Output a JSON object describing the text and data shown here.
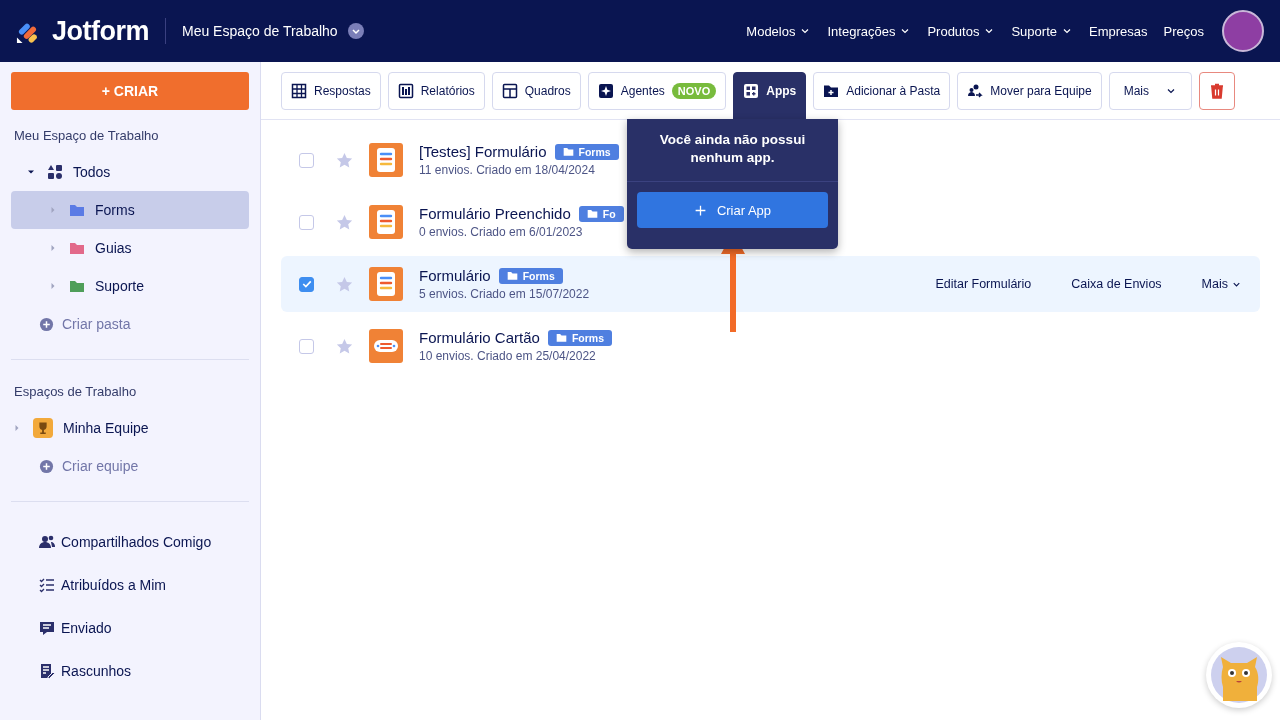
{
  "header": {
    "logo_text": "Jotform",
    "workspace": "Meu Espaço de Trabalho",
    "nav": [
      {
        "label": "Modelos",
        "dropdown": true
      },
      {
        "label": "Integrações",
        "dropdown": true
      },
      {
        "label": "Produtos",
        "dropdown": true
      },
      {
        "label": "Suporte",
        "dropdown": true
      },
      {
        "label": "Empresas",
        "dropdown": false
      },
      {
        "label": "Preços",
        "dropdown": false
      }
    ]
  },
  "sidebar": {
    "create_button": "+ CRIAR",
    "workspace_title": "Meu Espaço de Trabalho",
    "tree": [
      {
        "label": "Todos",
        "kind": "all",
        "expanded": true,
        "selected": false,
        "children": [
          {
            "label": "Forms",
            "kind": "folder",
            "color": "#5b7be5",
            "expanded": false,
            "selected": true
          },
          {
            "label": "Guias",
            "kind": "folder",
            "color": "#e2698a",
            "expanded": false,
            "selected": false
          },
          {
            "label": "Suporte",
            "kind": "folder",
            "color": "#4f9e5a",
            "expanded": false,
            "selected": false
          }
        ]
      }
    ],
    "create_folder": "Criar pasta",
    "teams_title": "Espaços de Trabalho",
    "teams": [
      {
        "label": "Minha Equipe",
        "expanded": false
      }
    ],
    "create_team": "Criar equipe",
    "links": [
      {
        "label": "Compartilhados Comigo",
        "kind": "shared"
      },
      {
        "label": "Atribuídos a Mim",
        "kind": "assigned"
      },
      {
        "label": "Enviado",
        "kind": "sent"
      },
      {
        "label": "Rascunhos",
        "kind": "drafts"
      }
    ]
  },
  "toolbar": [
    {
      "label": "Respostas",
      "kind": "grid",
      "selected": false
    },
    {
      "label": "Relatórios",
      "kind": "report",
      "selected": false
    },
    {
      "label": "Quadros",
      "kind": "board",
      "selected": false
    },
    {
      "label": "Agentes",
      "kind": "agent",
      "badge": "NOVO",
      "selected": false
    },
    {
      "label": "Apps",
      "kind": "apps",
      "selected": true
    },
    {
      "label": "Adicionar à Pasta",
      "kind": "folder",
      "selected": false
    },
    {
      "label": "Mover para Equipe",
      "kind": "team",
      "selected": false
    },
    {
      "label": "Mais",
      "kind": "more",
      "selected": false
    },
    {
      "kind": "delete",
      "selected": false
    }
  ],
  "forms": [
    {
      "title": "[Testes] Formulário",
      "tag": "Forms",
      "meta": "11 envios. Criado em 18/04/2024",
      "checked": false,
      "kind": "form"
    },
    {
      "title": "Formulário Preenchido",
      "tag": "Fo",
      "meta": "0 envios. Criado em 6/01/2023",
      "checked": false,
      "kind": "form"
    },
    {
      "title": "Formulário",
      "tag": "Forms",
      "meta": "5 envios. Criado em 15/07/2022",
      "checked": true,
      "kind": "form",
      "actions": [
        "Editar Formulário",
        "Caixa de Envios",
        "Mais"
      ]
    },
    {
      "title": "Formulário Cartão",
      "tag": "Forms",
      "meta": "10 envios. Criado em 25/04/2022",
      "checked": false,
      "kind": "card"
    }
  ],
  "popover": {
    "message": "Você ainda não possui nenhum app.",
    "button": "Criar App"
  }
}
